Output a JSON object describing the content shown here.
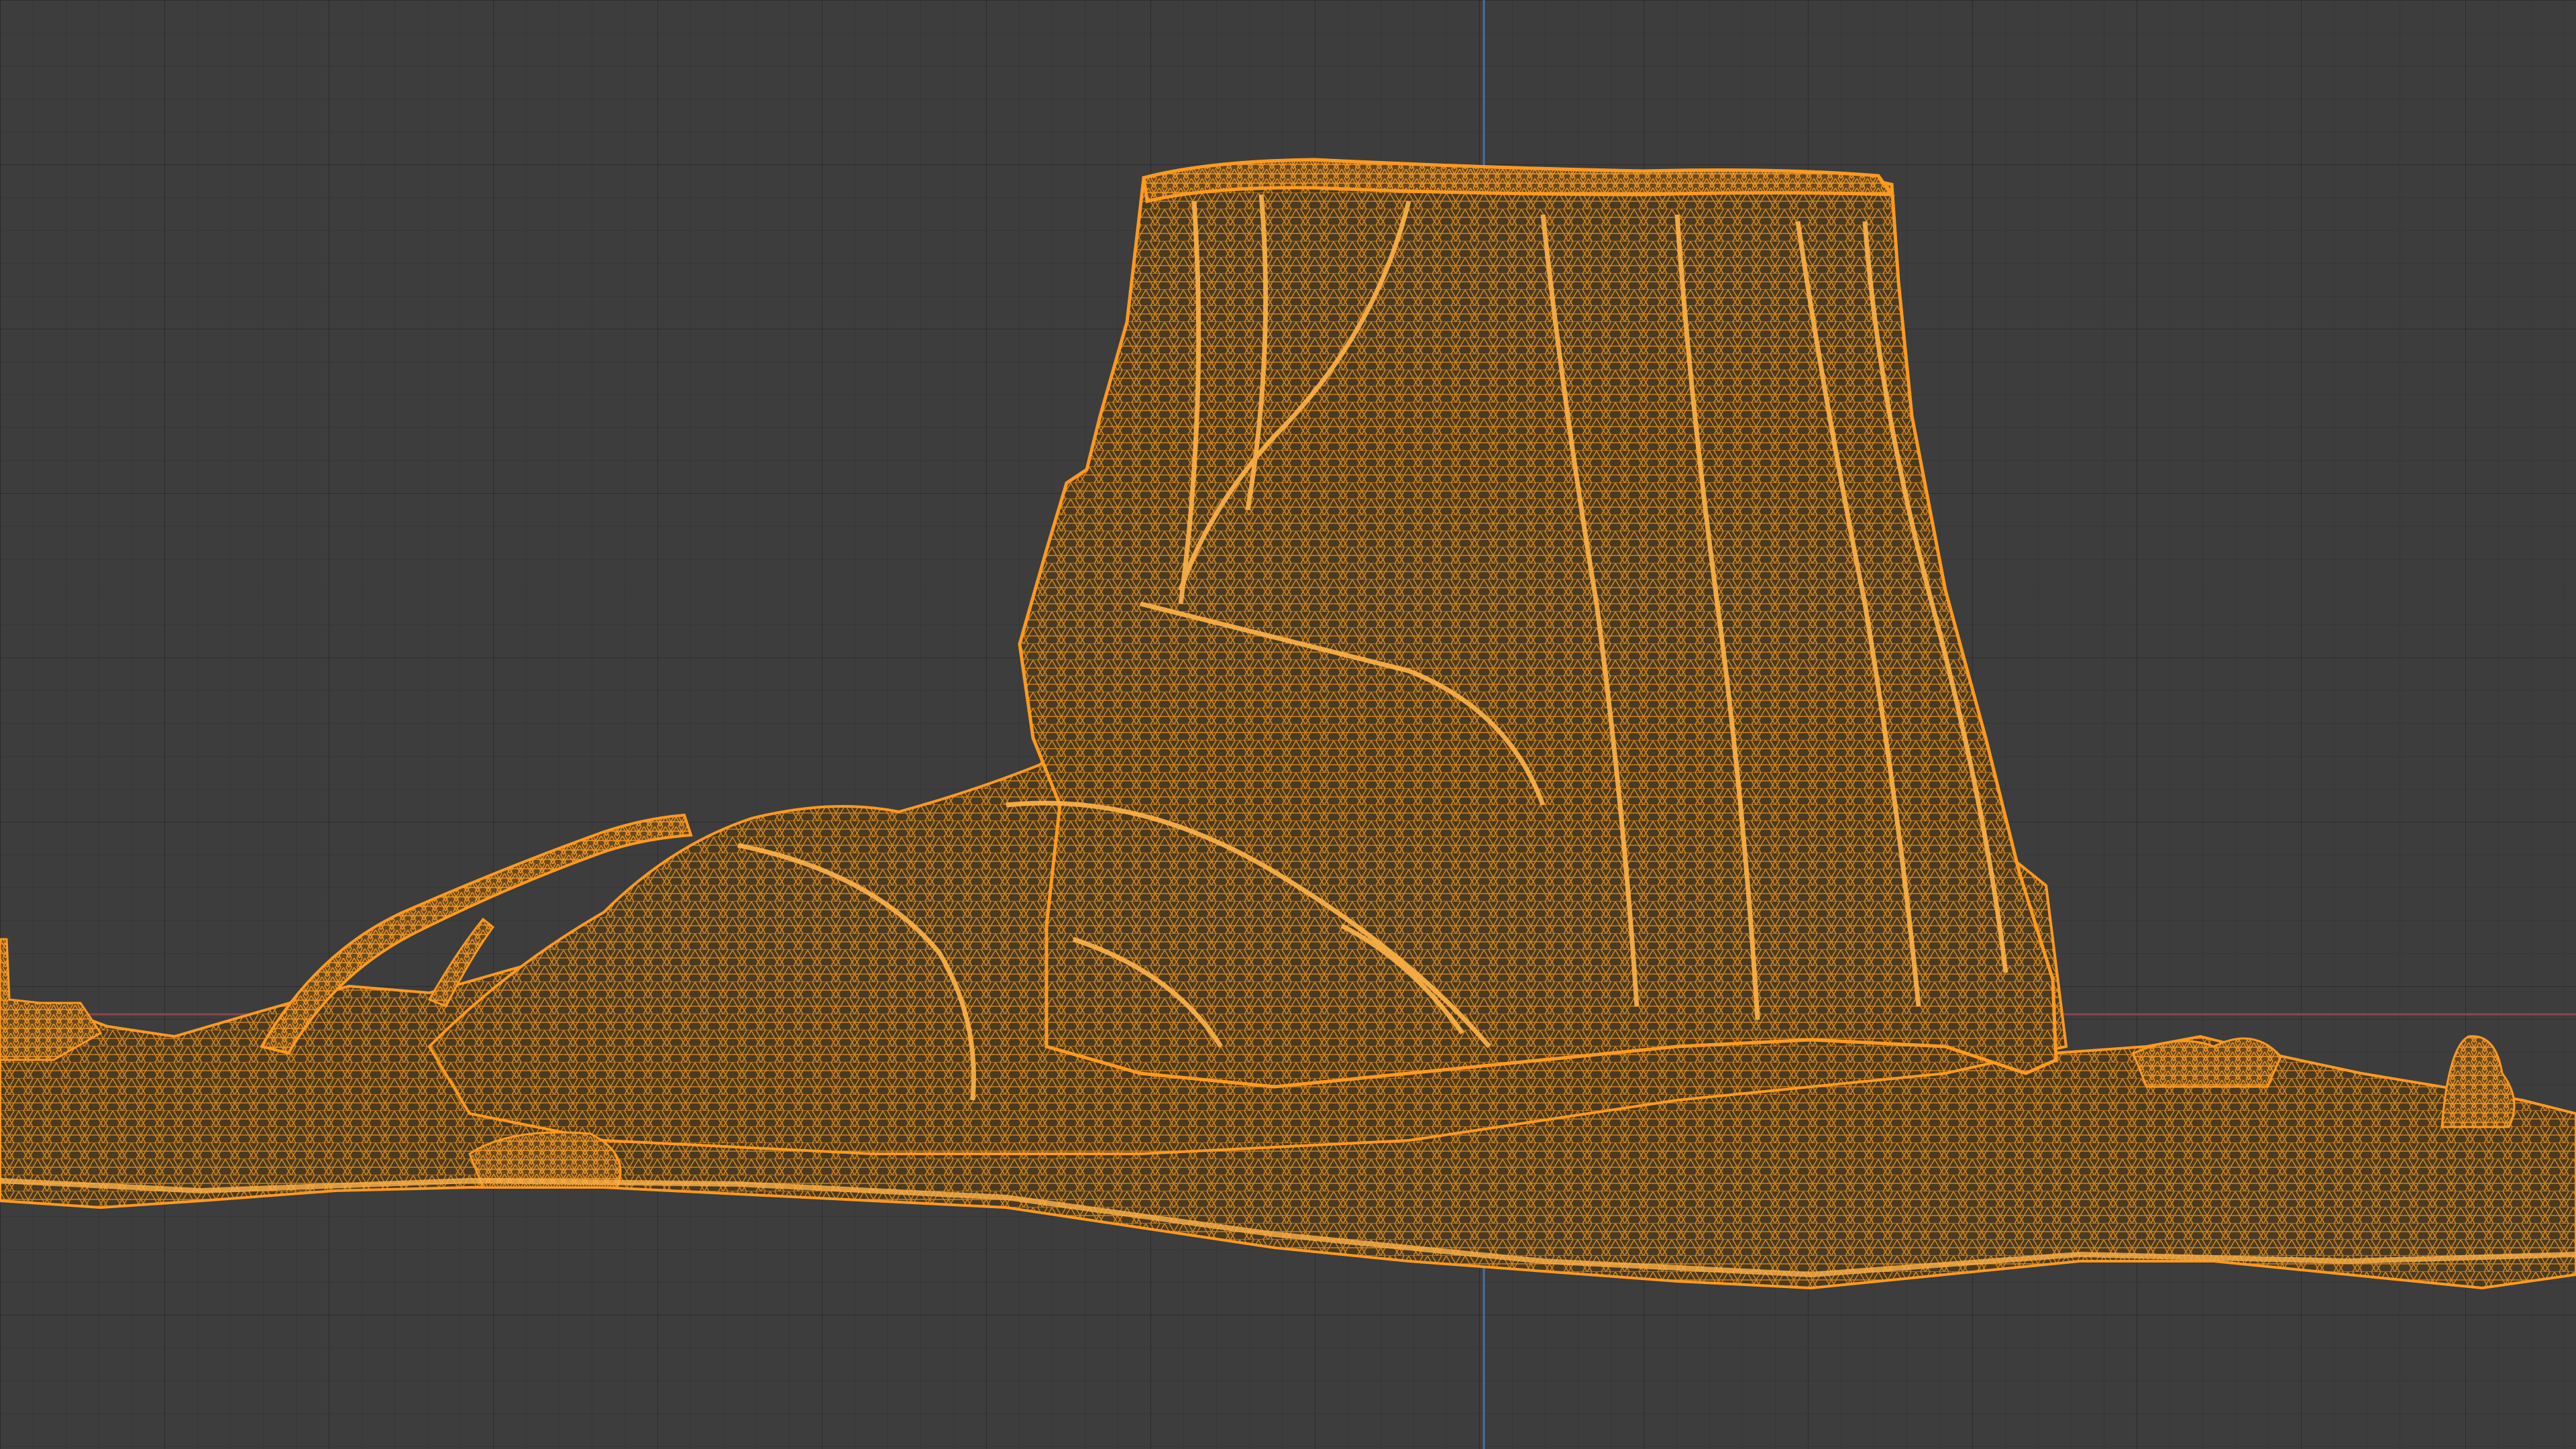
{
  "viewport": {
    "background_color": "#3d3d3d",
    "grid_major_color": "#333333",
    "grid_minor_color": "#383838",
    "x_axis_color": "#8a4650",
    "z_axis_color": "#4a6f9a"
  },
  "object": {
    "kind": "tree-stump-scan",
    "display_mode": "wireframe",
    "wire_color": "#ff9a1f",
    "selected": true
  }
}
